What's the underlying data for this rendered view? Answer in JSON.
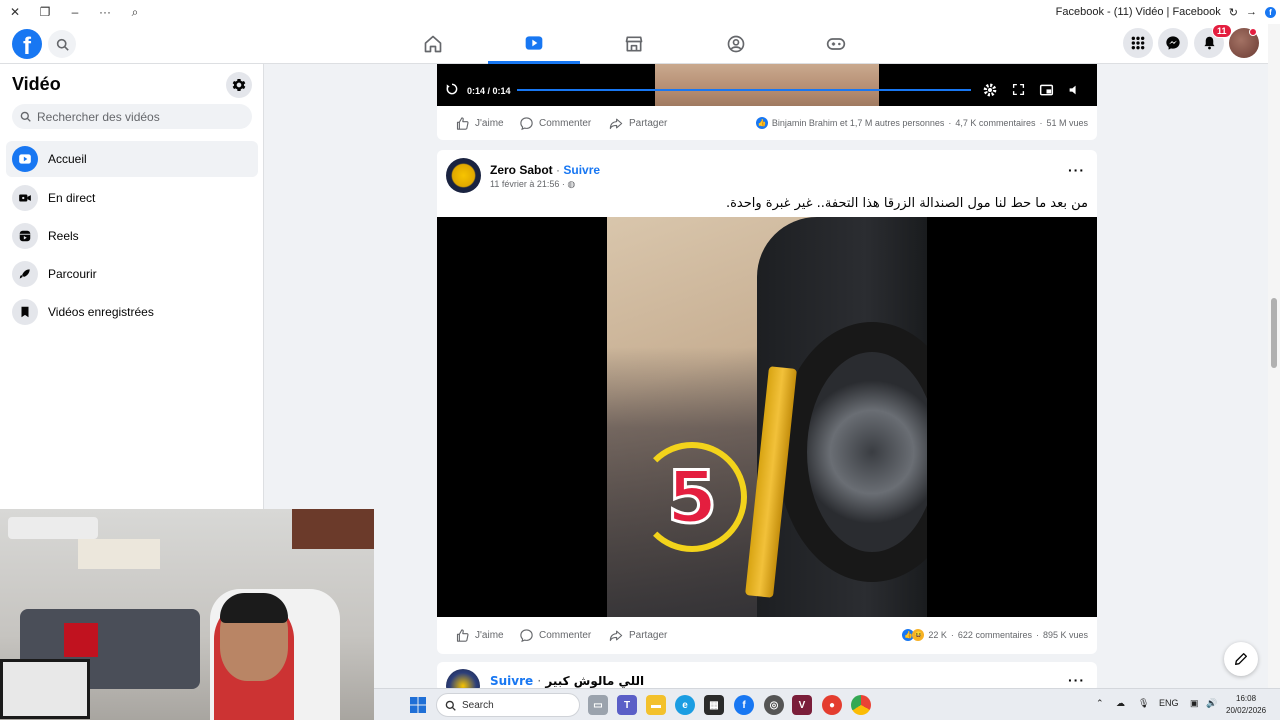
{
  "window": {
    "title": "Facebook - (11) Vidéo | Facebook"
  },
  "header": {
    "logo_letter": "f",
    "notifications_count": "11"
  },
  "sidebar": {
    "title": "Vidéo",
    "search_placeholder": "Rechercher des vidéos",
    "items": [
      {
        "label": "Accueil",
        "icon": "play-icon"
      },
      {
        "label": "En direct",
        "icon": "live-camera-icon"
      },
      {
        "label": "Reels",
        "icon": "reels-icon"
      },
      {
        "label": "Parcourir",
        "icon": "rocket-icon"
      },
      {
        "label": "Vidéos enregistrées",
        "icon": "bookmark-icon"
      }
    ]
  },
  "post1": {
    "video_time": "0:14 / 0:14",
    "like_label": "J'aime",
    "comment_label": "Commenter",
    "share_label": "Partager",
    "reactions_text": "Binjamin Brahim et 1,7 M autres personnes",
    "comments": "4,7 K commentaires",
    "views": "51 M vues"
  },
  "post2": {
    "author": "Zero Sabot",
    "follow": "Suivre",
    "separator": "·",
    "date": "11 février à 21:56 ·",
    "text": "من بعد ما حط لنا مول الصندالة الزرقا هذا التحفة.. غير غبرة واحدة.",
    "video_overlay_number": "5",
    "like_label": "J'aime",
    "comment_label": "Commenter",
    "share_label": "Partager",
    "reactions_count": "22 K",
    "comments": "622 commentaires",
    "views": "895 K vues"
  },
  "post3": {
    "author": "اللي مالوش كبير",
    "follow": "Suivre",
    "separator": "·"
  },
  "taskbar": {
    "search_label": "Search",
    "language": "ENG",
    "time": "16:08",
    "date": "20/02/2026"
  },
  "colors": {
    "brand": "#1877f2",
    "badge": "#e41e3f"
  }
}
